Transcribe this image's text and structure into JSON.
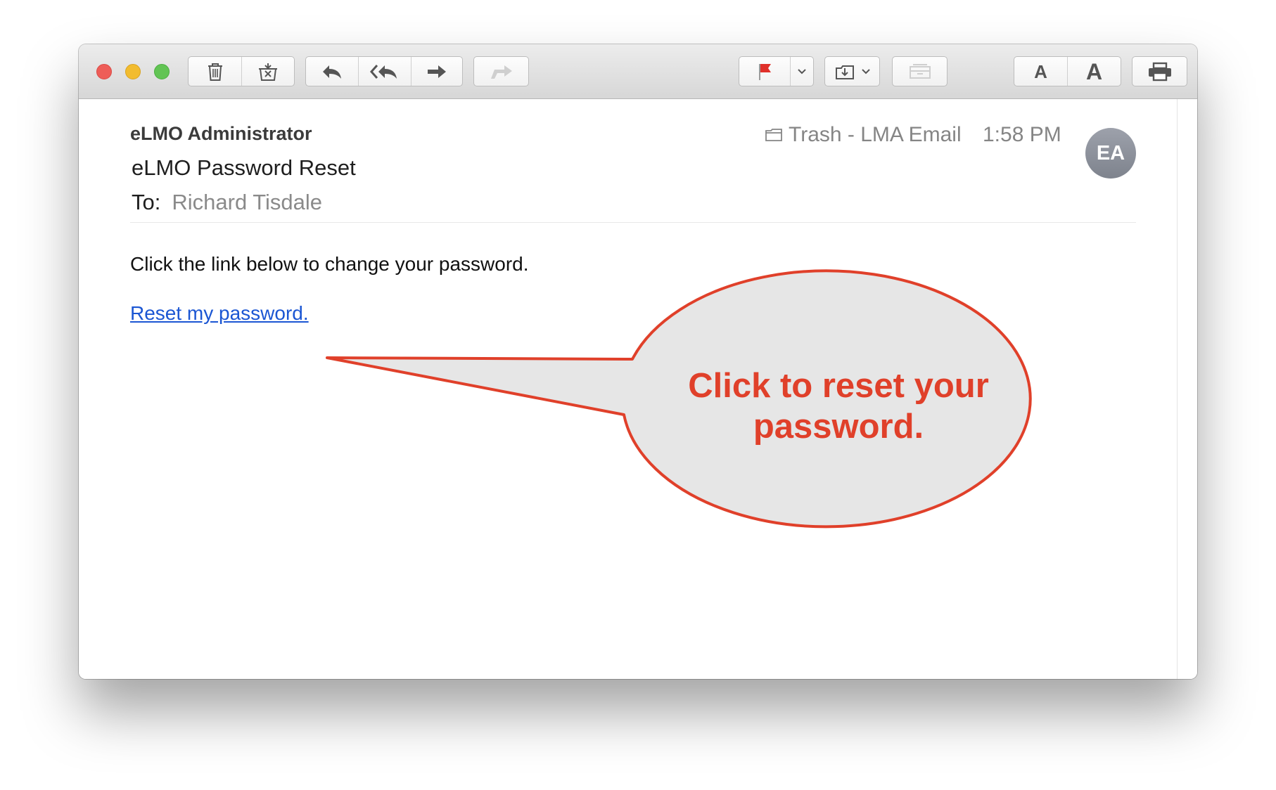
{
  "window": {
    "controls": [
      "close",
      "minimize",
      "zoom"
    ]
  },
  "toolbar": {
    "groups": [
      {
        "name": "delete-group",
        "buttons": [
          "trash-icon",
          "junk-icon"
        ]
      },
      {
        "name": "reply-group",
        "buttons": [
          "reply-icon",
          "reply-all-icon",
          "forward-icon"
        ]
      },
      {
        "name": "redirect-group",
        "buttons": [
          "redirect-icon"
        ]
      },
      {
        "name": "flag-group",
        "buttons": [
          "flag-icon",
          "chevron-down-icon"
        ]
      },
      {
        "name": "move-group",
        "buttons": [
          "move-to-icon",
          "chevron-down-icon"
        ]
      },
      {
        "name": "archive-group",
        "buttons": [
          "archive-icon"
        ]
      },
      {
        "name": "font-size-group",
        "buttons": [
          "smaller-font-icon",
          "larger-font-icon"
        ]
      },
      {
        "name": "print-group",
        "buttons": [
          "printer-icon"
        ]
      }
    ],
    "font_small_label": "A",
    "font_large_label": "A",
    "flag_color": "#e0302a"
  },
  "message": {
    "sender": "eLMO Administrator",
    "subject": "eLMO Password Reset",
    "to_label": "To:",
    "recipient": "Richard Tisdale",
    "mailbox": "Trash - LMA Email",
    "time": "1:58 PM",
    "avatar_initials": "EA",
    "body_text": "Click the link below to change your password.",
    "link_text": "Reset my password."
  },
  "callout": {
    "text_line1": "Click to reset your",
    "text_line2": "password.",
    "color": "#e0402a",
    "fill": "#e6e6e6"
  }
}
